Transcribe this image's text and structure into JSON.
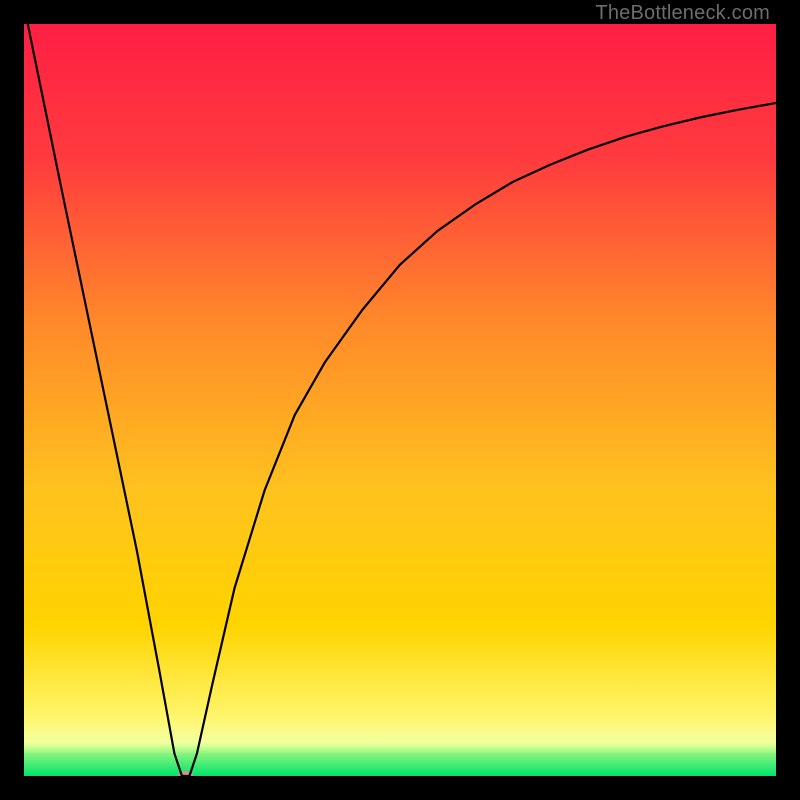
{
  "watermark": "TheBottleneck.com",
  "chart_data": {
    "type": "line",
    "title": "",
    "xlabel": "",
    "ylabel": "",
    "xlim": [
      0,
      100
    ],
    "ylim": [
      0,
      100
    ],
    "grid": false,
    "background_gradient": {
      "top_color": "#ff1f44",
      "mid_color": "#ffd400",
      "green_band_color": "#00e46a",
      "green_band_start_y_pct": 95.5,
      "green_band_end_y_pct": 100
    },
    "marker": {
      "x": 21.5,
      "y": 0,
      "color": "#d88b8f",
      "rx": 8,
      "ry": 5
    },
    "series": [
      {
        "name": "bottleneck-curve",
        "color": "#000000",
        "x": [
          0.5,
          5,
          10,
          15,
          18,
          20,
          21,
          22,
          23,
          25,
          28,
          32,
          36,
          40,
          45,
          50,
          55,
          60,
          65,
          70,
          75,
          80,
          85,
          90,
          95,
          100
        ],
        "y": [
          100,
          78,
          54,
          30,
          14,
          3,
          0,
          0,
          3,
          12,
          25,
          38,
          48,
          55,
          62,
          68,
          72.5,
          76,
          79,
          81.3,
          83.3,
          85,
          86.4,
          87.6,
          88.6,
          89.5
        ]
      }
    ]
  }
}
